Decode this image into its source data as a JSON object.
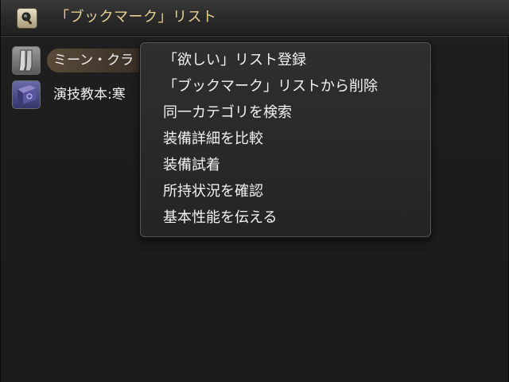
{
  "window": {
    "title": "「ブックマーク」リスト",
    "title_icon": "bookmark-lens-icon",
    "accent_title_color": "#e6cf92"
  },
  "list": {
    "items": [
      {
        "label": "ミーン・クラ",
        "icon": "boots-icon",
        "selected": true
      },
      {
        "label": "演技教本:寒",
        "icon": "book-icon",
        "selected": false
      }
    ]
  },
  "context_menu": {
    "items": [
      {
        "label": "「欲しい」リスト登録"
      },
      {
        "label": "「ブックマーク」リストから削除",
        "selected": true
      },
      {
        "label": "同一カテゴリを検索"
      },
      {
        "label": "装備詳細を比較"
      },
      {
        "label": "装備試着"
      },
      {
        "label": "所持状況を確認"
      },
      {
        "label": "基本性能を伝える"
      }
    ]
  }
}
